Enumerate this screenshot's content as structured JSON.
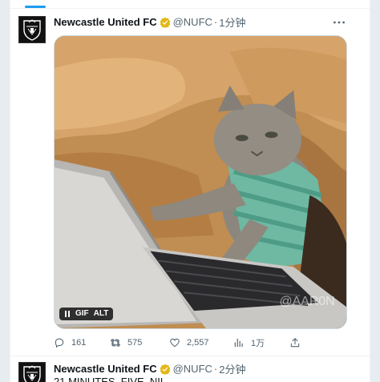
{
  "tweets": [
    {
      "author_name": "Newcastle United FC",
      "handle": "@NUFC",
      "separator": "·",
      "time": "1分钟",
      "media": {
        "badges": [
          "GIF",
          "ALT"
        ],
        "watermark": "@AAR0N"
      },
      "stats": {
        "replies": "161",
        "retweets": "575",
        "likes": "2,557",
        "views": "1万"
      }
    },
    {
      "author_name": "Newcastle United FC",
      "handle": "@NUFC",
      "separator": "·",
      "time": "2分钟",
      "text": "21 MINUTES. FIVE. NIL."
    }
  ],
  "colors": {
    "accent": "#1d9bf0",
    "verified_gold": "#e2b719",
    "muted_text": "#536471"
  },
  "icons": [
    "verified-badge-icon",
    "more-icon",
    "reply-icon",
    "retweet-icon",
    "like-icon",
    "views-icon",
    "share-icon",
    "pause-icon"
  ]
}
